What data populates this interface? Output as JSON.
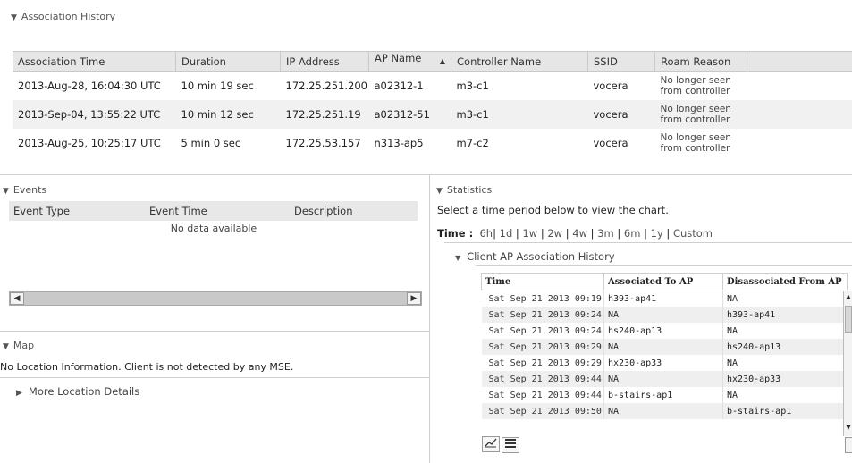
{
  "association_history": {
    "title": "Association History",
    "columns": [
      "Association Time",
      "Duration",
      "IP Address",
      "AP Name",
      "Controller Name",
      "SSID",
      "Roam Reason"
    ],
    "rows": [
      {
        "time": "2013-Aug-28, 16:04:30 UTC",
        "duration": "10 min 19 sec",
        "ip": "172.25.251.200",
        "ap": "a02312-1",
        "controller": "m3-c1",
        "ssid": "vocera",
        "roam1": "No longer seen",
        "roam2": "from controller"
      },
      {
        "time": "2013-Sep-04, 13:55:22 UTC",
        "duration": "10 min 12 sec",
        "ip": "172.25.251.19",
        "ap": "a02312-51",
        "controller": "m3-c1",
        "ssid": "vocera",
        "roam1": "No longer seen",
        "roam2": "from controller"
      },
      {
        "time": "2013-Aug-25, 10:25:17 UTC",
        "duration": "5 min 0 sec",
        "ip": "172.25.53.157",
        "ap": "n313-ap5",
        "controller": "m7-c2",
        "ssid": "vocera",
        "roam1": "No longer seen",
        "roam2": "from controller"
      }
    ]
  },
  "events": {
    "title": "Events",
    "columns": [
      "Event Type",
      "Event Time",
      "Description"
    ],
    "empty_text": "No data available"
  },
  "map": {
    "title": "Map",
    "message": "No Location Information. Client is not detected by any MSE.",
    "more_label": "More Location Details"
  },
  "statistics": {
    "title": "Statistics",
    "message": "Select a time period below to view the chart.",
    "time_label": "Time :",
    "time_options": [
      "6h",
      "1d",
      "1w",
      "2w",
      "4w",
      "3m",
      "6m",
      "1y",
      "Custom"
    ],
    "client_ap": {
      "title": "Client AP Association History",
      "columns": [
        "Time",
        "Associated To AP",
        "Disassociated From AP"
      ],
      "rows": [
        {
          "time": "Sat Sep 21 2013 09:19",
          "assoc": "h393-ap41",
          "disassoc": "NA"
        },
        {
          "time": "Sat Sep 21 2013 09:24",
          "assoc": "NA",
          "disassoc": "h393-ap41"
        },
        {
          "time": "Sat Sep 21 2013 09:24",
          "assoc": "hs240-ap13",
          "disassoc": "NA"
        },
        {
          "time": "Sat Sep 21 2013 09:29",
          "assoc": "NA",
          "disassoc": "hs240-ap13"
        },
        {
          "time": "Sat Sep 21 2013 09:29",
          "assoc": "hx230-ap33",
          "disassoc": "NA"
        },
        {
          "time": "Sat Sep 21 2013 09:44",
          "assoc": "NA",
          "disassoc": "hx230-ap33"
        },
        {
          "time": "Sat Sep 21 2013 09:44",
          "assoc": "b-stairs-ap1",
          "disassoc": "NA"
        },
        {
          "time": "Sat Sep 21 2013 09:50",
          "assoc": "NA",
          "disassoc": "b-stairs-ap1"
        }
      ]
    }
  },
  "icons": {
    "collapse": "triangle-down-icon",
    "expand": "triangle-right-icon",
    "sort": "sort-asc-icon",
    "chart_view": "line-chart-icon",
    "table_view": "table-icon"
  }
}
